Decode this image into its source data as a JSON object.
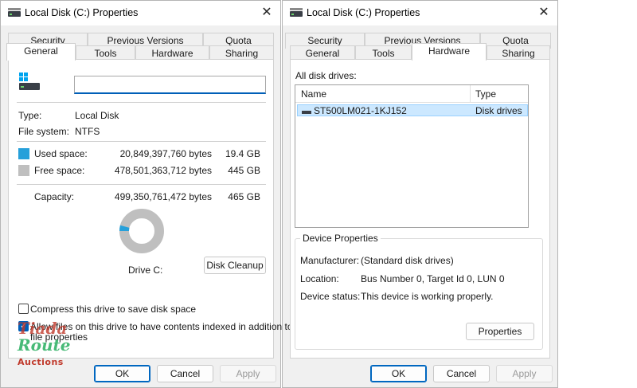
{
  "left": {
    "title": "Local Disk (C:) Properties",
    "close": "✕",
    "tabs_row1": [
      "Security",
      "Previous Versions",
      "Quota"
    ],
    "tabs_row2": [
      "General",
      "Tools",
      "Hardware",
      "Sharing"
    ],
    "active_tab": "General",
    "name_value": "",
    "type_label": "Type:",
    "type_value": "Local Disk",
    "fs_label": "File system:",
    "fs_value": "NTFS",
    "used_label": "Used space:",
    "used_bytes": "20,849,397,760 bytes",
    "used_gb": "19.4 GB",
    "free_label": "Free space:",
    "free_bytes": "478,501,363,712 bytes",
    "free_gb": "445 GB",
    "capacity_label": "Capacity:",
    "capacity_bytes": "499,350,761,472 bytes",
    "capacity_gb": "465 GB",
    "used_fraction": 0.0418,
    "drive_label": "Drive C:",
    "cleanup_button": "Disk Cleanup",
    "compress_label": "Compress this drive to save disk space",
    "compress_checked": false,
    "index_label": "Allow files on this drive to have contents indexed in addition to",
    "index_label2": "file properties",
    "index_checked": true,
    "ok": "OK",
    "cancel": "Cancel",
    "apply": "Apply",
    "colors": {
      "used": "#26a0da",
      "free": "#bfbfbf"
    }
  },
  "right": {
    "title": "Local Disk (C:) Properties",
    "close": "✕",
    "tabs_row1": [
      "Security",
      "Previous Versions",
      "Quota"
    ],
    "tabs_row2": [
      "General",
      "Tools",
      "Hardware",
      "Sharing"
    ],
    "active_tab": "Hardware",
    "all_drives_label": "All disk drives:",
    "columns": [
      "Name",
      "Type"
    ],
    "drives": [
      {
        "name": "ST500LM021-1KJ152",
        "type": "Disk drives"
      }
    ],
    "device_props_title": "Device Properties",
    "manufacturer_label": "Manufacturer:",
    "manufacturer_value": "(Standard disk drives)",
    "location_label": "Location:",
    "location_value": "Bus Number 0, Target Id 0, LUN 0",
    "status_label": "Device status:",
    "status_value": "This device is working properly.",
    "properties_button": "Properties",
    "ok": "OK",
    "cancel": "Cancel",
    "apply": "Apply"
  },
  "watermark": {
    "line1": "Tiada",
    "line2": "Route",
    "line3": "Auctions"
  }
}
